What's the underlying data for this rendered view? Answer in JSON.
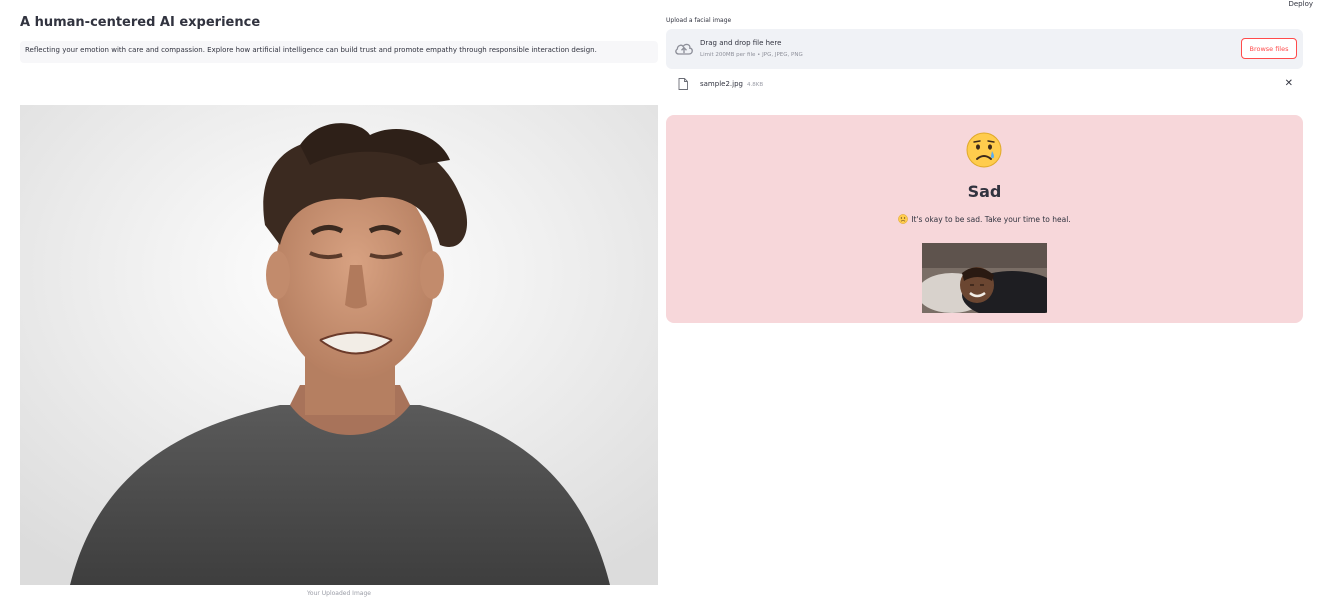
{
  "header": {
    "deploy_label": "Deploy"
  },
  "main": {
    "title": "A human-centered AI experience",
    "description": "Reflecting your emotion with care and compassion. Explore how artificial intelligence can build trust and promote empathy through responsible interaction design.",
    "image_caption": "Your Uploaded Image"
  },
  "uploader": {
    "label": "Upload a facial image",
    "drop_title": "Drag and drop file here",
    "limit_text": "Limit 200MB per file • JPG, JPEG, PNG",
    "browse_label": "Browse files",
    "file": {
      "name": "sample2.jpg",
      "size": "4.8KB",
      "remove_glyph": "✕"
    }
  },
  "result": {
    "emotion": "Sad",
    "message": "It's okay to be sad. Take your time to heal."
  },
  "icons": [
    "cloud-upload-icon",
    "file-icon",
    "close-icon",
    "crying-face-icon",
    "sad-face-icon"
  ],
  "colors": {
    "accent": "#ff4b4b",
    "card_bg": "#f7d7da",
    "dropzone_bg": "#f0f2f6"
  }
}
